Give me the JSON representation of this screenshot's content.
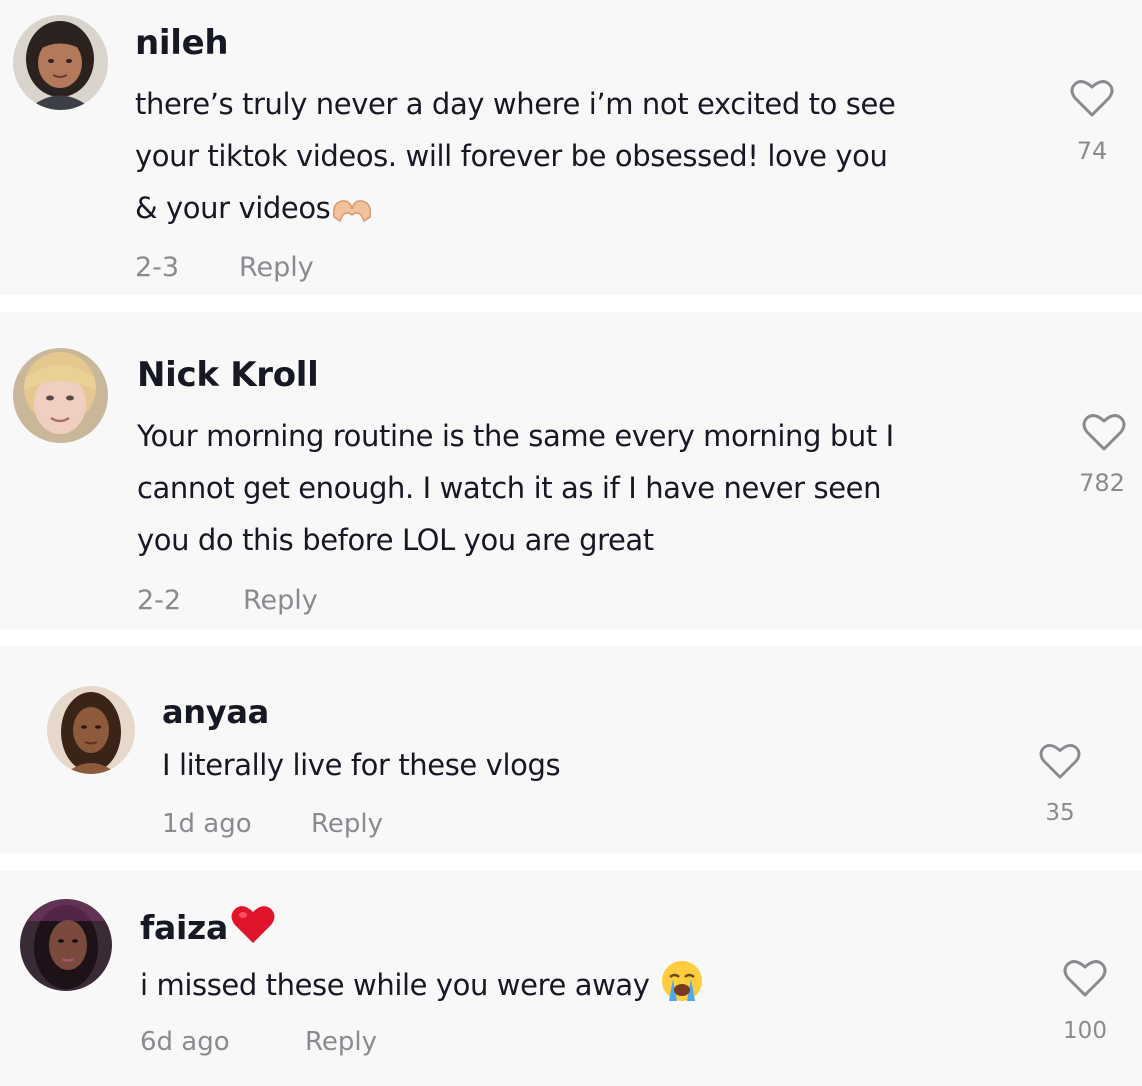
{
  "comments": [
    {
      "username": "nileh",
      "lines": [
        "there’s truly never a day where i’m not excited to see",
        "your tiktok videos. will forever be obsessed! love you",
        "& your videos"
      ],
      "emoji": "heart-hands-emoji",
      "date": "2-3",
      "reply_label": "Reply",
      "likes": "74"
    },
    {
      "username": "Nick Kroll",
      "lines": [
        "Your morning routine is the same every morning but I",
        "cannot get enough. I watch it as if I have never seen",
        "you do this before LOL you are great"
      ],
      "date": "2-2",
      "reply_label": "Reply",
      "likes": "782"
    },
    {
      "username": "anyaa",
      "lines": [
        "I literally live for these vlogs"
      ],
      "date": "1d ago",
      "reply_label": "Reply",
      "likes": "35"
    },
    {
      "username": "faiza",
      "username_emoji": "red-heart-emoji",
      "lines": [
        "i missed these while you were away"
      ],
      "emoji": "loudly-crying-emoji",
      "date": "6d ago",
      "reply_label": "Reply",
      "likes": "100"
    }
  ],
  "colors": {
    "background": "#f8f8f8",
    "separator": "#ffffff",
    "text": "#161823",
    "muted": "#8a8b91"
  }
}
